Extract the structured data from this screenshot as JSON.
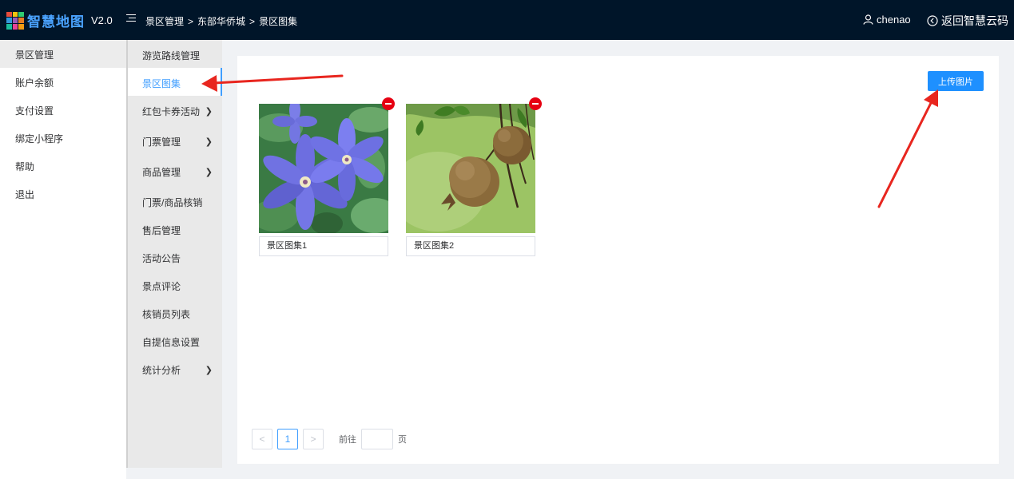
{
  "header": {
    "logo_text": "智慧地图",
    "version": "V2.0",
    "breadcrumb": [
      "景区管理",
      "东部华侨城",
      "景区图集"
    ],
    "breadcrumb_sep": ">",
    "user_name": "chenao",
    "back_label": "返回智慧云码"
  },
  "sidebar": {
    "items": [
      {
        "label": "景区管理"
      },
      {
        "label": "账户余额"
      },
      {
        "label": "支付设置"
      },
      {
        "label": "绑定小程序"
      },
      {
        "label": "帮助"
      },
      {
        "label": "退出"
      }
    ]
  },
  "submenu": {
    "items": [
      {
        "label": "游览路线管理"
      },
      {
        "label": "景区图集"
      },
      {
        "label": "红包卡券活动"
      },
      {
        "label": "门票管理"
      },
      {
        "label": "商品管理"
      },
      {
        "label": "门票/商品核销"
      },
      {
        "label": "售后管理"
      },
      {
        "label": "活动公告"
      },
      {
        "label": "景点评论"
      },
      {
        "label": "核销员列表"
      },
      {
        "label": "自提信息设置"
      },
      {
        "label": "统计分析"
      }
    ]
  },
  "main": {
    "upload_label": "上传图片",
    "gallery": [
      {
        "caption": "景区图集1",
        "image": "purple-clematis-flower"
      },
      {
        "caption": "景区图集2",
        "image": "pomegranate-fruit"
      }
    ],
    "pagination": {
      "current_page": "1",
      "goto_label": "前往",
      "page_unit": "页",
      "prev_icon": "<",
      "next_icon": ">"
    }
  },
  "colors": {
    "topbar": "#001529",
    "accent": "#409eff",
    "upload_button": "#1e90ff",
    "delete_badge": "#e60012",
    "annotation_arrow": "#e8261f"
  }
}
